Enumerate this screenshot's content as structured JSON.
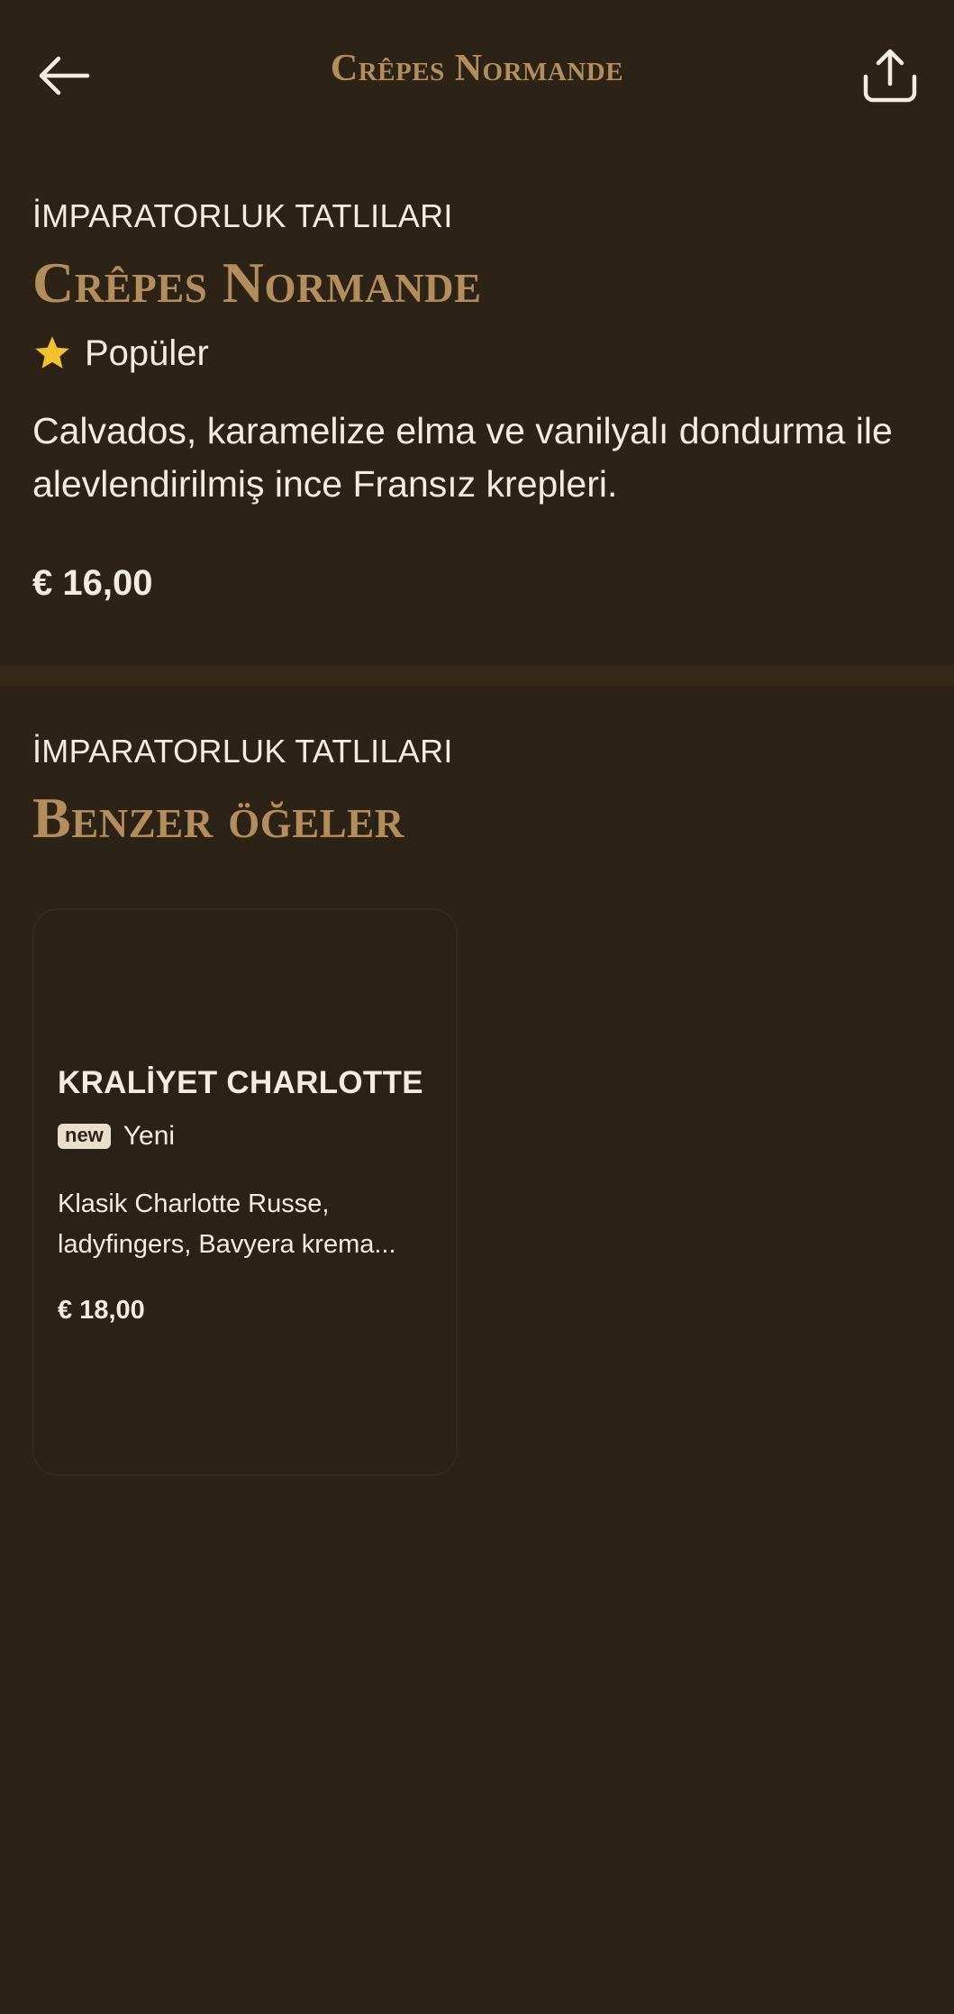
{
  "header": {
    "title": "Crêpes Normande",
    "back_icon": "arrow-left-icon",
    "share_icon": "share-icon"
  },
  "item": {
    "category": "İMPARATORLUK TATLILARI",
    "name": "Crêpes Normande",
    "badge_icon": "star-icon",
    "badge_label": "Popüler",
    "description": "Calvados, karamelize elma ve vanilyalı dondurma ile alevlendirilmiş ince Fransız krepleri.",
    "price": "€ 16,00"
  },
  "similar": {
    "category": "İMPARATORLUK TATLILARI",
    "heading": "Benzer öğeler",
    "items": [
      {
        "name": "KRALİYET CHARLOTTE",
        "badge_pill": "new",
        "badge_label": "Yeni",
        "description_line1": "Klasik Charlotte Russe,",
        "description_line2": "ladyfingers, Bavyera krema...",
        "price": "€ 18,00"
      }
    ]
  },
  "colors": {
    "background": "#2c2316",
    "accent_gold": "#b38d5b",
    "text": "#f3ece0",
    "star": "#f2c12e"
  }
}
